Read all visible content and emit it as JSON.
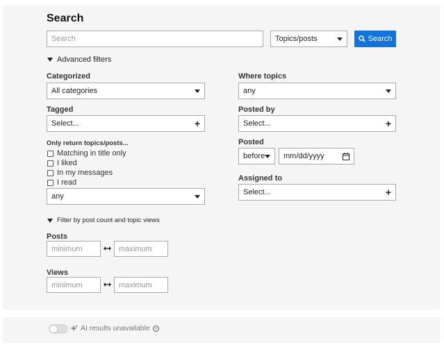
{
  "page": {
    "title": "Search"
  },
  "search": {
    "placeholder": "Search",
    "type_select": "Topics/posts",
    "button_label": "Search"
  },
  "advanced": {
    "toggle_label": "Advanced filters",
    "categorized": {
      "label": "Categorized",
      "value": "All categories"
    },
    "tagged": {
      "label": "Tagged",
      "value": "Select..."
    },
    "only_return": {
      "label": "Only return topics/posts...",
      "options": [
        "Matching in title only",
        "I liked",
        "In my messages",
        "I read"
      ],
      "select_value": "any"
    },
    "where_topics": {
      "label": "Where topics",
      "value": "any"
    },
    "posted_by": {
      "label": "Posted by",
      "value": "Select..."
    },
    "posted": {
      "label": "Posted",
      "when": "before",
      "date_placeholder": "mm/dd/yyyy"
    },
    "assigned_to": {
      "label": "Assigned to",
      "value": "Select..."
    }
  },
  "post_count": {
    "toggle_label": "Filter by post count and topic views",
    "posts": {
      "label": "Posts",
      "min_placeholder": "minimum",
      "max_placeholder": "maximum"
    },
    "views": {
      "label": "Views",
      "min_placeholder": "minimum",
      "max_placeholder": "maximum"
    }
  },
  "ai": {
    "label": "AI results unavailable",
    "enabled": false
  }
}
